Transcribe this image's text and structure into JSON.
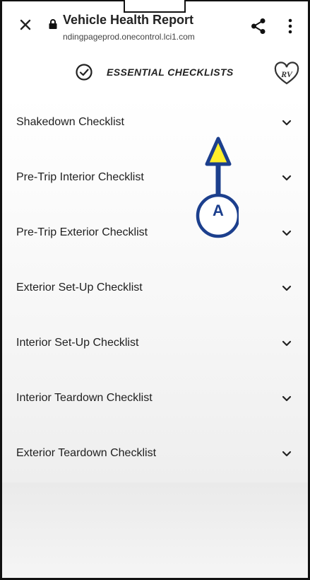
{
  "browser": {
    "title": "Vehicle Health Report",
    "url": "ndingpageprod.onecontrol.lci1.com"
  },
  "header": {
    "title": "ESSENTIAL CHECKLISTS",
    "logo_text": "RV"
  },
  "checklists": [
    {
      "label": "Shakedown Checklist"
    },
    {
      "label": "Pre-Trip Interior Checklist"
    },
    {
      "label": "Pre-Trip Exterior Checklist"
    },
    {
      "label": "Exterior Set-Up Checklist"
    },
    {
      "label": "Interior Set-Up Checklist"
    },
    {
      "label": "Interior Teardown Checklist"
    },
    {
      "label": "Exterior Teardown Checklist"
    }
  ],
  "annotation": {
    "label": "A",
    "colors": {
      "fill": "#ffef2b",
      "stroke": "#1c3f8d"
    }
  }
}
